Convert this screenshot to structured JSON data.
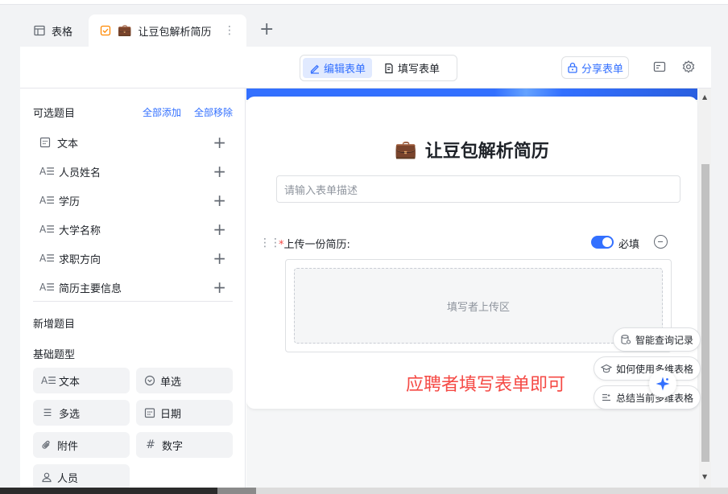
{
  "tabs": [
    {
      "label": "表格",
      "icon": "table-icon"
    },
    {
      "label": "让豆包解析简历",
      "icon": "form-icon",
      "emoji": "💼"
    }
  ],
  "tab_add_label": "+",
  "toolbar": {
    "edit_form": "编辑表单",
    "fill_form": "填写表单",
    "share_form": "分享表单"
  },
  "sidebar": {
    "available_title": "可选题目",
    "add_all": "全部添加",
    "remove_all": "全部移除",
    "fields": [
      {
        "label": "文本",
        "icon": "calendar-grid-icon"
      },
      {
        "label": "人员姓名",
        "icon": "text-field-icon"
      },
      {
        "label": "学历",
        "icon": "text-field-icon"
      },
      {
        "label": "大学名称",
        "icon": "text-field-icon"
      },
      {
        "label": "求职方向",
        "icon": "text-field-icon"
      },
      {
        "label": "简历主要信息",
        "icon": "text-field-icon"
      }
    ],
    "new_title": "新增题目",
    "basic_types_title": "基础题型",
    "types": [
      {
        "label": "文本",
        "icon": "text-field-icon"
      },
      {
        "label": "单选",
        "icon": "single-select-icon"
      },
      {
        "label": "多选",
        "icon": "multi-select-icon"
      },
      {
        "label": "日期",
        "icon": "date-icon"
      },
      {
        "label": "附件",
        "icon": "attachment-icon"
      },
      {
        "label": "数字",
        "icon": "number-icon"
      },
      {
        "label": "人员",
        "icon": "person-icon"
      }
    ]
  },
  "form": {
    "emoji": "💼",
    "title": "让豆包解析简历",
    "description_placeholder": "请输入表单描述",
    "question": {
      "required_mark": "*",
      "label": "上传一份简历:",
      "required_label": "必填",
      "required_on": true,
      "upload_hint": "填写者上传区"
    },
    "annotation": "应聘者填写表单即可"
  },
  "assistant": {
    "suggestions": [
      "智能查询记录",
      "如何使用多维表格",
      "总结当前多维表格"
    ]
  },
  "colors": {
    "accent": "#3370ff",
    "annotation": "#f54a45"
  }
}
